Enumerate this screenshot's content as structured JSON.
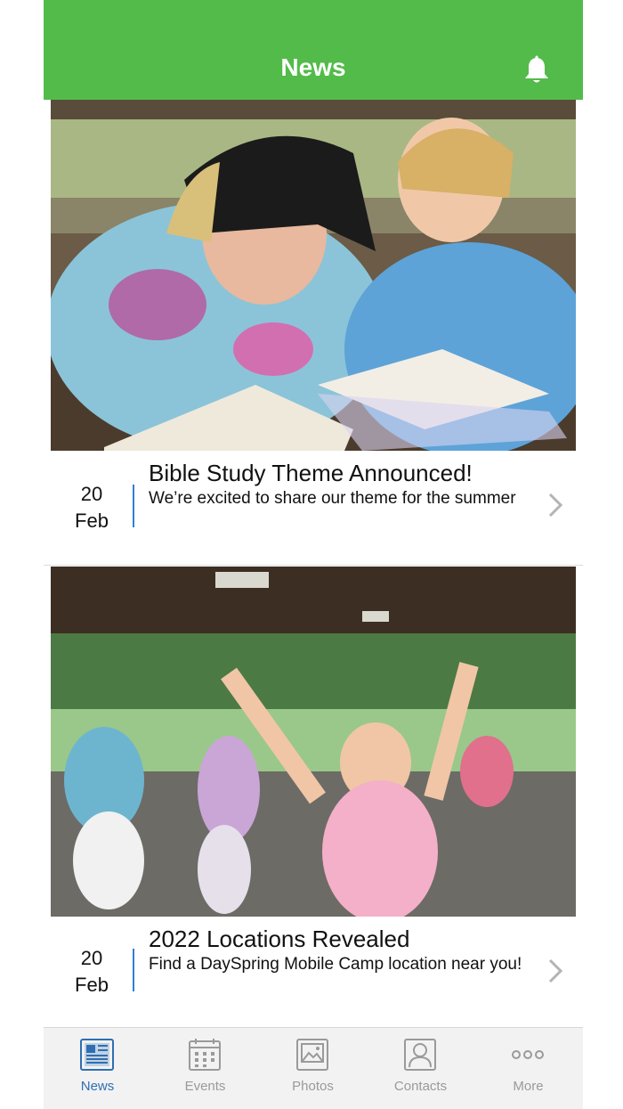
{
  "header": {
    "title": "News",
    "bell_icon": "bell-icon"
  },
  "accent_color": "#53bb4a",
  "news": [
    {
      "day": "20",
      "month": "Feb",
      "title": "Bible Study Theme Announced!",
      "description": "We’re excited to share our theme for the summer",
      "image": "photo of two girls in tie-dye shirts reading Bibles at a picnic table"
    },
    {
      "day": "20",
      "month": "Feb",
      "title": "2022 Locations Revealed",
      "description": "Find a DaySpring Mobile Camp location near you!",
      "image": "photo of children raising arms under a picnic pavilion"
    }
  ],
  "tabs": [
    {
      "label": "News",
      "icon": "newspaper-icon",
      "active": true
    },
    {
      "label": "Events",
      "icon": "calendar-icon",
      "active": false
    },
    {
      "label": "Photos",
      "icon": "photo-icon",
      "active": false
    },
    {
      "label": "Contacts",
      "icon": "contact-icon",
      "active": false
    },
    {
      "label": "More",
      "icon": "more-icon",
      "active": false
    }
  ]
}
